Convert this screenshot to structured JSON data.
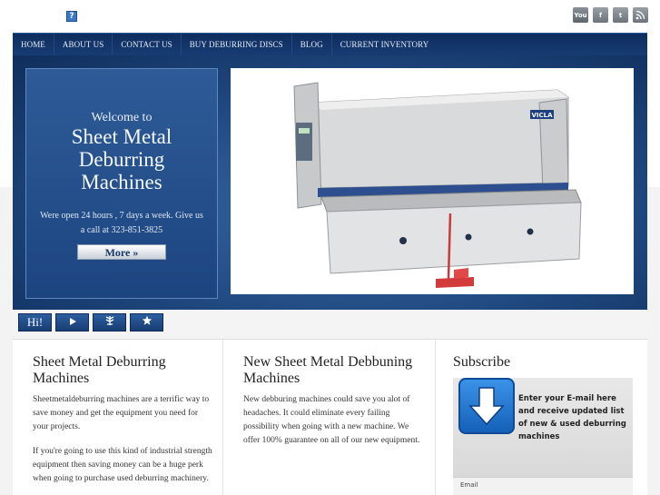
{
  "nav": {
    "items": [
      "HOME",
      "ABOUT US",
      "CONTACT US",
      "BUY DEBURRING DISCS",
      "BLOG",
      "CURRENT INVENTORY"
    ]
  },
  "social": {
    "icons": [
      "youtube-icon",
      "facebook-icon",
      "twitter-icon",
      "rss-icon"
    ]
  },
  "hero": {
    "welcome": "Welcome to",
    "headline_line1": "Sheet Metal",
    "headline_line2": "Deburring",
    "headline_line3": "Machines",
    "text": "Were open 24 hours , 7 days a week. Give us a call at 323-851-3825",
    "more_label": "More »",
    "machine_brand": "VICLA"
  },
  "tabs": {
    "hi_label": "Hi!"
  },
  "columns": {
    "col1": {
      "title": "Sheet Metal Deburring Machines",
      "p1": "Sheetmetaldeburring machines are a terrific way to save money and get the equipment you need for your projects.",
      "p2": "If you're going to use this kind of industrial strength equipment then saving money can be a huge perk when going to purchase used deburring machinery."
    },
    "col2": {
      "title": "New Sheet Metal Debbuning Machines",
      "p1": "New debburing machines could save you alot of headaches. It could eliminate every failing possibility when going with a new machine. We offer 100% guarantee on all of our new equipment."
    },
    "col3": {
      "title": "Subscribe",
      "text": "Enter your E-mail here and receive updated list of new & used deburring machines",
      "email_label": "Email"
    }
  },
  "colors": {
    "nav_bg": "#173c74",
    "hero_bg": "#1f487f",
    "accent_blue": "#2c5ea0"
  }
}
